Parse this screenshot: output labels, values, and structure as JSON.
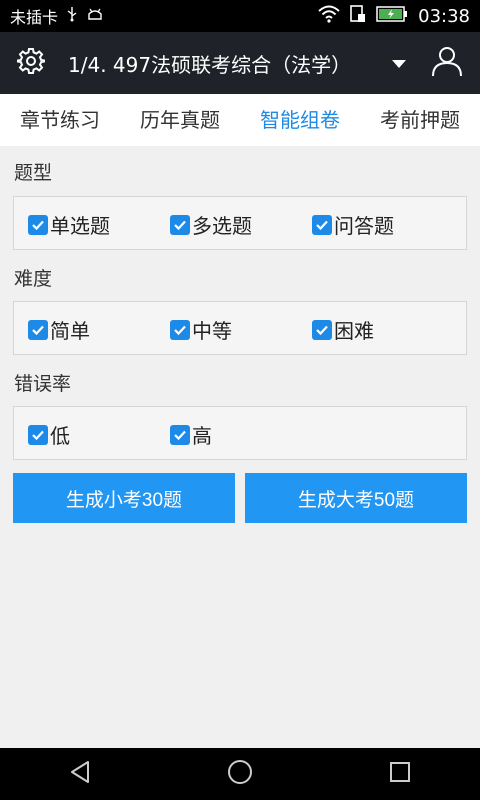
{
  "status_bar": {
    "carrier": "未插卡",
    "time": "03:38"
  },
  "header": {
    "title": "1/4. 497法硕联考综合（法学）"
  },
  "tabs": [
    {
      "label": "章节练习"
    },
    {
      "label": "历年真题"
    },
    {
      "label": "智能组卷",
      "active": true
    },
    {
      "label": "考前押题"
    }
  ],
  "sections": {
    "type": {
      "title": "题型",
      "options": [
        {
          "label": "单选题",
          "checked": true
        },
        {
          "label": "多选题",
          "checked": true
        },
        {
          "label": "问答题",
          "checked": true
        }
      ]
    },
    "difficulty": {
      "title": "难度",
      "options": [
        {
          "label": "简单",
          "checked": true
        },
        {
          "label": "中等",
          "checked": true
        },
        {
          "label": "困难",
          "checked": true
        }
      ]
    },
    "error_rate": {
      "title": "错误率",
      "options": [
        {
          "label": "低",
          "checked": true
        },
        {
          "label": "高",
          "checked": true
        }
      ]
    }
  },
  "buttons": {
    "small_exam": "生成小考30题",
    "big_exam": "生成大考50题"
  },
  "colors": {
    "accent": "#1e8ae8",
    "button": "#2196f3",
    "header_bg": "#1f2329"
  }
}
